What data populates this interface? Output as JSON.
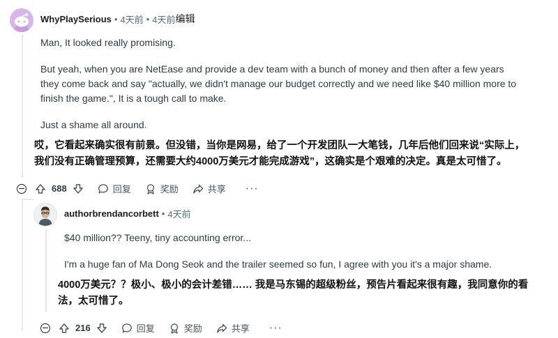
{
  "comment1": {
    "username": "WhyPlaySerious",
    "time": "4天前",
    "edited_time": "4天前",
    "edited_label": "编辑",
    "paragraphs": [
      "Man, It looked really promising.",
      "But yeah, when you are NetEase and provide a dev team with a bunch of money and then after a few years",
      "they come back and say \"actually, we didn't manage our budget correctly and we need like $40 million more to",
      "finish the game.\", It is a tough call to make.",
      "Just a shame all around."
    ],
    "translation": [
      "哎，它看起来确实很有前景。但没错，当你是网易，给了一个开发团队一大笔钱，几年后他们回来说“实际上，",
      "我们没有正确管理预算，还需要大约4000万美元才能完成游戏”，这确实是个艰难的决定。真是太可惜了。"
    ],
    "actions": {
      "votes": "688",
      "reply": "回复",
      "award": "奖励",
      "share": "共享",
      "more": "···"
    }
  },
  "comment2": {
    "username": "authorbrendancorbett",
    "time": "4天前",
    "paragraphs": [
      "$40 million?? Teeny, tiny accounting error...",
      "I'm a huge fan of Ma Dong Seok and the trailer seemed so fun, I agree with you it's a major shame."
    ],
    "translation": [
      "4000万美元？？极小、极小的会计差错…… 我是马东锡的超级粉丝，预告片看起来很有趣，我同意你的看",
      "法，太可惜了。"
    ],
    "actions": {
      "votes": "216",
      "reply": "回复",
      "award": "奖励",
      "share": "共享",
      "more": "···"
    }
  },
  "colors": {
    "avatar1_bg": "#d7b6e8",
    "meta_gray": "#576f76",
    "thread_line": "#e5e7ea"
  }
}
